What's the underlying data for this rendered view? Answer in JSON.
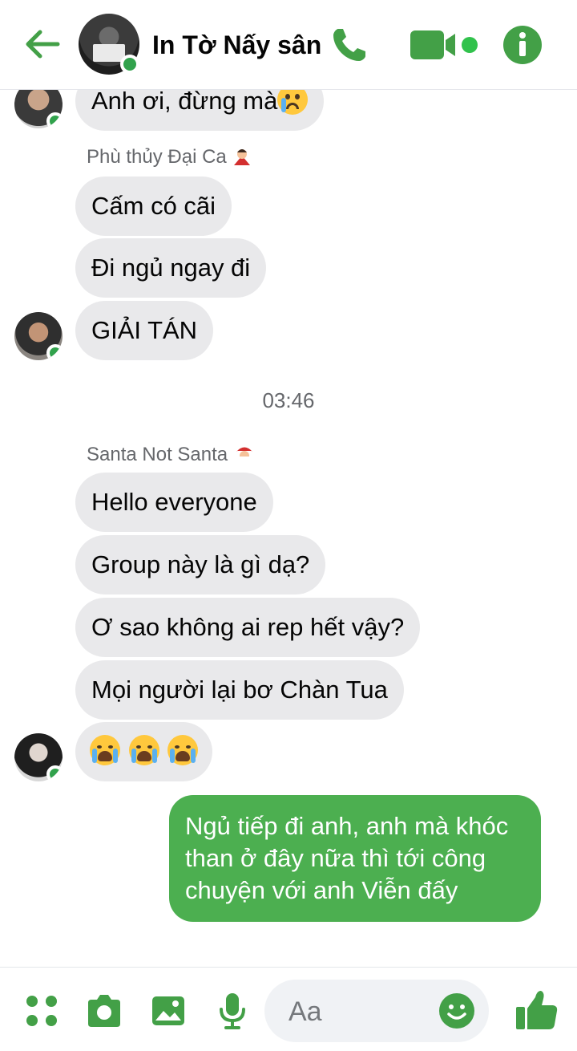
{
  "header": {
    "title": "In Tờ Nấy sân"
  },
  "messages": {
    "m1": "Anh ơi, đừng mà",
    "sender1": "Phù thủy Đại Ca",
    "m2": "Cấm có cãi",
    "m3": "Đi ngủ ngay đi",
    "m4": "GIẢI TÁN",
    "timestamp": "03:46",
    "sender2": "Santa Not Santa",
    "m5": "Hello everyone",
    "m6": "Group này là gì dạ?",
    "m7": "Ơ sao không ai rep hết vậy?",
    "m8": "Mọi người lại bơ Chàn Tua",
    "outgoing": "Ngủ tiếp đi anh, anh mà khóc than ở đây nữa thì tới công chuyện với anh Viễn đấy"
  },
  "composer": {
    "placeholder": "Aa"
  },
  "colors": {
    "accent": "#4caf50",
    "icon_green": "#43a047",
    "online": "#31a24c",
    "incoming_bubble": "#e9e9eb"
  },
  "icons": [
    "back-arrow-icon",
    "phone-icon",
    "video-camera-icon",
    "info-icon",
    "menu-dots-icon",
    "camera-icon",
    "image-icon",
    "microphone-icon",
    "smiley-icon",
    "thumbs-up-icon"
  ]
}
